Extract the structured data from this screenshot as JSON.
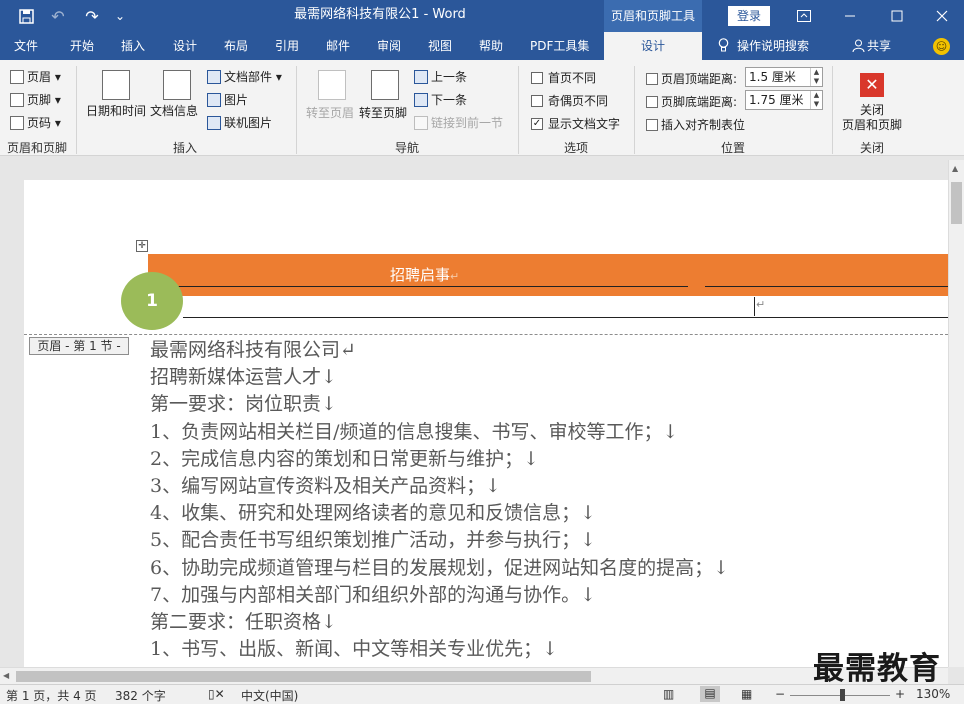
{
  "window": {
    "title": "最需网络科技有限公1  -  Word",
    "context_tab": "页眉和页脚工具",
    "login": "登录",
    "quick_access": {
      "redo_symbol": "↷",
      "undo_symbol": "↶",
      "customize_symbol": "⌄"
    }
  },
  "tabs": [
    {
      "label": "文件",
      "active": false
    },
    {
      "label": "开始",
      "active": false
    },
    {
      "label": "插入",
      "active": false
    },
    {
      "label": "设计",
      "active": false
    },
    {
      "label": "布局",
      "active": false
    },
    {
      "label": "引用",
      "active": false
    },
    {
      "label": "邮件",
      "active": false
    },
    {
      "label": "审阅",
      "active": false
    },
    {
      "label": "视图",
      "active": false
    },
    {
      "label": "帮助",
      "active": false
    },
    {
      "label": "PDF工具集",
      "active": false
    },
    {
      "label": "设计",
      "active": true
    }
  ],
  "tell_me": "操作说明搜索",
  "share": "共享",
  "ribbon": {
    "header_footer": {
      "header": "页眉",
      "footer": "页脚",
      "page_number": "页码",
      "group_label": "页眉和页脚"
    },
    "insert": {
      "date_time": "日期和时间",
      "doc_info": "文档信息",
      "doc_parts": "文档部件",
      "picture": "图片",
      "online_picture": "联机图片",
      "group_label": "插入"
    },
    "navigation": {
      "goto_header": "转至页眉",
      "goto_footer": "转至页脚",
      "previous": "上一条",
      "next": "下一条",
      "link_previous": "链接到前一节",
      "group_label": "导航"
    },
    "options": {
      "different_first": "首页不同",
      "different_odd_even": "奇偶页不同",
      "show_doc_text": "显示文档文字",
      "show_doc_text_checked": "✓",
      "group_label": "选项"
    },
    "position": {
      "header_top_label": "页眉顶端距离:",
      "header_top_value": "1.5 厘米",
      "footer_bottom_label": "页脚底端距离:",
      "footer_bottom_value": "1.75 厘米",
      "insert_align_tab": "插入对齐制表位",
      "group_label": "位置"
    },
    "close": {
      "label_line1": "关闭",
      "label_line2": "页眉和页脚",
      "group_label": "关闭"
    }
  },
  "document": {
    "header_banner_text": "招聘启事",
    "header_mark": "↵",
    "badge_number": "1",
    "header_tag": "页眉 - 第 1 节 -",
    "move_handle": "✛",
    "lines": [
      "最需网络科技有限公司↵",
      "招聘新媒体运营人才↓",
      "第一要求：岗位职责↓",
      "1、负责网站相关栏目/频道的信息搜集、书写、审校等工作；↓",
      "2、完成信息内容的策划和日常更新与维护；↓",
      "3、编写网站宣传资料及相关产品资料；↓",
      "4、收集、研究和处理网络读者的意见和反馈信息；↓",
      "5、配合责任书写组织策划推广活动，并参与执行；↓",
      "6、协助完成频道管理与栏目的发展规划，促进网站知名度的提高；↓",
      "7、加强与内部相关部门和组织外部的沟通与协作。↓",
      "第二要求：任职资格↓",
      "1、书写、出版、新闻、中文等相关专业优先；↓"
    ]
  },
  "watermark": "最需教育",
  "status": {
    "page": "第 1 页，共 4 页",
    "words": "382 个字",
    "language": "中文(中国)",
    "zoom": "130%",
    "zoom_minus": "−",
    "zoom_plus": "+"
  },
  "colors": {
    "accent": "#2b579a",
    "banner": "#ed7d31",
    "badge": "#9bbb59"
  }
}
